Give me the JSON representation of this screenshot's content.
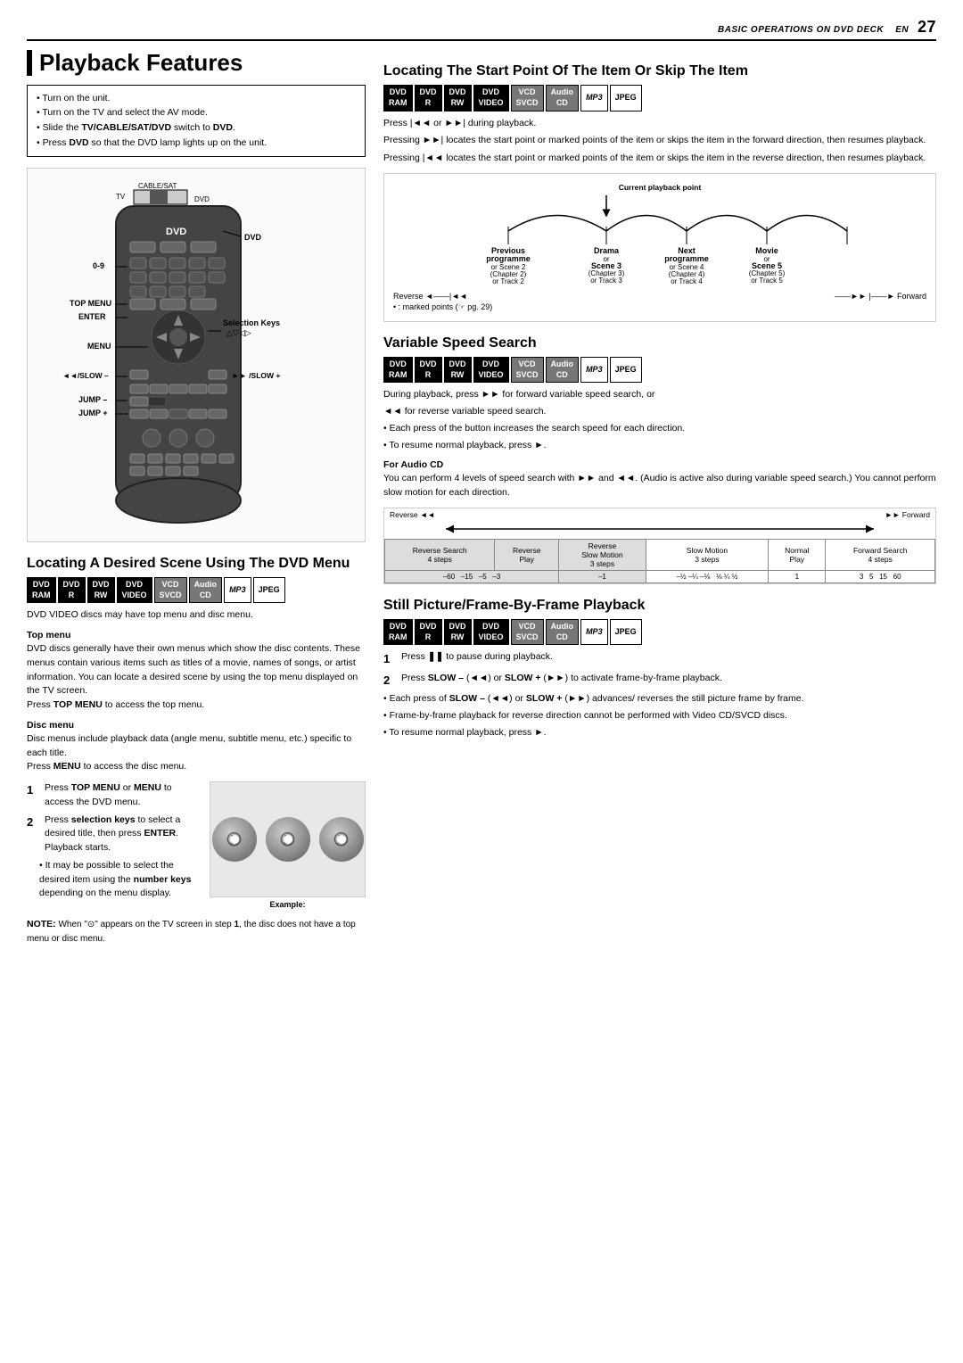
{
  "header": {
    "title": "BASIC OPERATIONS ON DVD DECK",
    "lang": "EN",
    "page": "27"
  },
  "page_title": "Playback Features",
  "intro": {
    "items": [
      "Turn on the unit.",
      "Turn on the TV and select the AV mode.",
      "Slide the TV/CABLE/SAT/DVD switch to DVD.",
      "Press DVD so that the DVD lamp lights up on the unit."
    ]
  },
  "locating_scene": {
    "title": "Locating A Desired Scene Using The DVD Menu",
    "badges": [
      {
        "label": "DVD\nRAM",
        "style": "highlight"
      },
      {
        "label": "DVD\nR",
        "style": "highlight"
      },
      {
        "label": "DVD\nRW",
        "style": "highlight"
      },
      {
        "label": "DVD\nVIDEO",
        "style": "highlight"
      },
      {
        "label": "VCD\nSVCD",
        "style": "gray"
      },
      {
        "label": "Audio\nCD",
        "style": "gray"
      },
      {
        "label": "MP3",
        "style": "mp3"
      },
      {
        "label": "JPEG",
        "style": "jpeg"
      }
    ],
    "intro_text": "DVD VIDEO discs may have top menu and disc menu.",
    "top_menu": {
      "heading": "Top menu",
      "text": "DVD discs generally have their own menus which show the disc contents. These menus contain various items such as titles of a movie, names of songs, or artist information. You can locate a desired scene by using the top menu displayed on the TV screen.\nPress TOP MENU to access the top menu."
    },
    "disc_menu": {
      "heading": "Disc menu",
      "text": "Disc menus include playback data (angle menu, subtitle menu, etc.) specific to each title.\nPress MENU to access the disc menu."
    },
    "steps": [
      {
        "num": "1",
        "text": "Press TOP MENU or MENU to access the DVD menu."
      },
      {
        "num": "2",
        "text": "Press selection keys to select a desired title, then press ENTER. Playback starts."
      }
    ],
    "bullet": "It may be possible to select the desired item using the number keys depending on the menu display.",
    "example_label": "Example:",
    "note_title": "NOTE:",
    "note_text": "When \"⊙\" appears on the TV screen in step 1, the disc does not have a top menu or disc menu."
  },
  "locating_start": {
    "title": "Locating The Start Point Of The Item Or Skip The Item",
    "badges": [
      {
        "label": "DVD\nRAM",
        "style": "highlight"
      },
      {
        "label": "DVD\nR",
        "style": "highlight"
      },
      {
        "label": "DVD\nRW",
        "style": "highlight"
      },
      {
        "label": "DVD\nVIDEO",
        "style": "highlight"
      },
      {
        "label": "VCD\nSVCD",
        "style": "gray"
      },
      {
        "label": "Audio\nCD",
        "style": "gray"
      },
      {
        "label": "MP3",
        "style": "mp3"
      },
      {
        "label": "JPEG",
        "style": "jpeg"
      }
    ],
    "press_text": "Press |◄◄ or ►►| during playback.",
    "bullets": [
      "Pressing ►►| locates the start point or marked points of the item or skips the item in the forward direction, then resumes playback.",
      "Pressing |◄◄ locates the start point or marked points of the item or skips the item in the reverse direction, then resumes playback."
    ],
    "diagram": {
      "current_label": "Current playback point",
      "columns": [
        {
          "title": "Previous\nprogramme",
          "sub": "or\nScene 2\n(Chapter 2)\nor\nTrack 2"
        },
        {
          "title": "Drama\nor\nScene 3\n(Chapter 3)\nor\nTrack 3",
          "bold": true
        },
        {
          "title": "Next\nprogramme",
          "sub": "or\nScene 4\n(Chapter 4)\nor\nTrack 4"
        },
        {
          "title": "Movie\nor\nScene 5\n(Chapter 5)\nor\nTrack 5"
        }
      ],
      "reverse_label": "Reverse",
      "forward_label": "Forward",
      "marked_note": "• : marked points (☞ pg. 29)"
    }
  },
  "variable_speed": {
    "title": "Variable Speed Search",
    "badges": [
      {
        "label": "DVD\nRAM",
        "style": "highlight"
      },
      {
        "label": "DVD\nR",
        "style": "highlight"
      },
      {
        "label": "DVD\nRW",
        "style": "highlight"
      },
      {
        "label": "DVD\nVIDEO",
        "style": "highlight"
      },
      {
        "label": "VCD\nSVCD",
        "style": "gray"
      },
      {
        "label": "Audio\nCD",
        "style": "gray"
      },
      {
        "label": "MP3",
        "style": "mp3"
      },
      {
        "label": "JPEG",
        "style": "jpeg"
      }
    ],
    "bullets": [
      "During playback, press ►► for forward variable speed search, or",
      "◄◄ for reverse variable speed search.",
      "Each press of the button increases the search speed for each direction.",
      "To resume normal playback, press ►."
    ],
    "for_audio_cd": {
      "heading": "For Audio CD",
      "text": "You can perform 4 levels of speed search with ►► and ◄◄. (Audio is active also during variable speed search.) You cannot perform slow motion for each direction."
    },
    "diagram": {
      "reverse_label": "Reverse ◄◄",
      "forward_label": "►► Forward",
      "rows": [
        [
          "Reverse Search\n4 steps",
          "Reverse\nPlay",
          "Reverse\nSlow Motion\n3 steps",
          "Slow Motion\n3 steps",
          "Normal\nPlay",
          "Forward Search\n4 steps"
        ],
        [
          "–60",
          "–15",
          "–5",
          "–3",
          "–1",
          "–½",
          "–¼",
          "–⅛",
          "⅛",
          "¼",
          "½",
          "1",
          "3",
          "5",
          "15",
          "60"
        ]
      ]
    }
  },
  "still_picture": {
    "title": "Still Picture/Frame-By-Frame Playback",
    "badges": [
      {
        "label": "DVD\nRAM",
        "style": "highlight"
      },
      {
        "label": "DVD\nR",
        "style": "highlight"
      },
      {
        "label": "DVD\nRW",
        "style": "highlight"
      },
      {
        "label": "DVD\nVIDEO",
        "style": "highlight"
      },
      {
        "label": "VCD\nSVCD",
        "style": "gray"
      },
      {
        "label": "Audio\nCD",
        "style": "gray"
      },
      {
        "label": "MP3",
        "style": "mp3"
      },
      {
        "label": "JPEG",
        "style": "jpeg"
      }
    ],
    "steps": [
      {
        "num": "1",
        "text": "Press ❚❚ to pause during playback."
      },
      {
        "num": "2",
        "text": "Press SLOW – (◄◄) or SLOW + (►►) to activate frame-by-frame playback."
      }
    ],
    "bullets": [
      "Each press of SLOW – (◄◄) or SLOW + (►►) advances/ reverses the still picture frame by frame.",
      "Frame-by-frame playback for reverse direction cannot be performed with Video CD/SVCD discs.",
      "To resume normal playback, press ►."
    ]
  },
  "remote": {
    "labels": {
      "dvd": "DVD",
      "zero_nine": "0-9",
      "top_menu": "TOP MENU",
      "enter": "ENTER",
      "menu": "MENU",
      "slow_minus": "◄◄/SLOW –",
      "slow_plus": "►► /SLOW +",
      "jump_minus": "JUMP –",
      "jump_plus": "JUMP +",
      "selection_keys": "Selection Keys",
      "cable_sat": "CABLE/SAT"
    }
  }
}
